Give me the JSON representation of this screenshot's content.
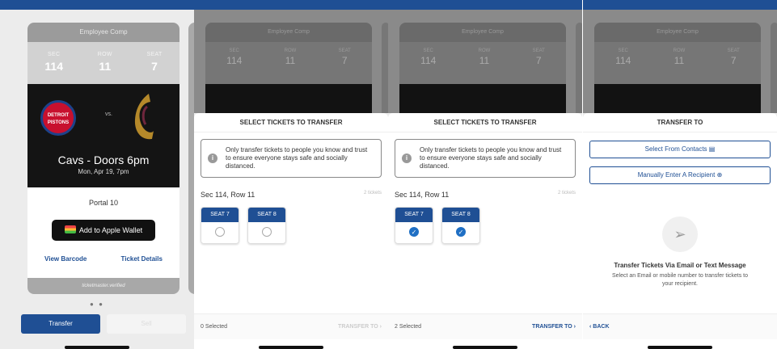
{
  "screen1": {
    "card_header": "Employee Comp",
    "sec_label": "SEC",
    "sec_value": "114",
    "row_label": "ROW",
    "row_value": "11",
    "seat_label": "SEAT",
    "seat_value": "7",
    "home_logo_text": "DETROIT PISTONS",
    "vs": "vs.",
    "event_title": "Cavs - Doors 6pm",
    "event_date": "Mon, Apr 19, 7pm",
    "portal": "Portal 10",
    "wallet_label": "Add to Apple Wallet",
    "view_barcode": "View Barcode",
    "ticket_details": "Ticket Details",
    "tm_verified": "ticketmaster.verified",
    "pager": "● ●",
    "transfer_label": "Transfer",
    "sell_label": "Sell"
  },
  "screen2": {
    "sheet_title": "SELECT TICKETS TO TRANSFER",
    "notice": "Only transfer tickets to people you know and trust to ensure everyone stays safe and socially distanced.",
    "section": "Sec 114, Row 11",
    "ticket_count": "2 tickets",
    "seat_a": "SEAT 7",
    "seat_b": "SEAT 8",
    "selected": "0 Selected",
    "transfer_to": "TRANSFER TO"
  },
  "screen3": {
    "sheet_title": "SELECT TICKETS TO TRANSFER",
    "notice": "Only transfer tickets to people you know and trust to ensure everyone stays safe and socially distanced.",
    "section": "Sec 114, Row 11",
    "ticket_count": "2 tickets",
    "seat_a": "SEAT 7",
    "seat_b": "SEAT 8",
    "selected": "2 Selected",
    "transfer_to": "TRANSFER TO"
  },
  "screen4": {
    "sheet_title": "TRANSFER TO",
    "from_contacts": "Select From Contacts",
    "manual": "Manually Enter A Recipient",
    "heading": "Transfer Tickets Via Email or Text Message",
    "sub": "Select an Email or mobile number to transfer tickets to your recipient.",
    "back": "BACK"
  },
  "background_dim": {
    "card_header": "Employee Comp",
    "sec": "114",
    "row": "11",
    "seat": "7"
  },
  "colors": {
    "accent": "#1f4f94",
    "check": "#1f6fc4"
  }
}
